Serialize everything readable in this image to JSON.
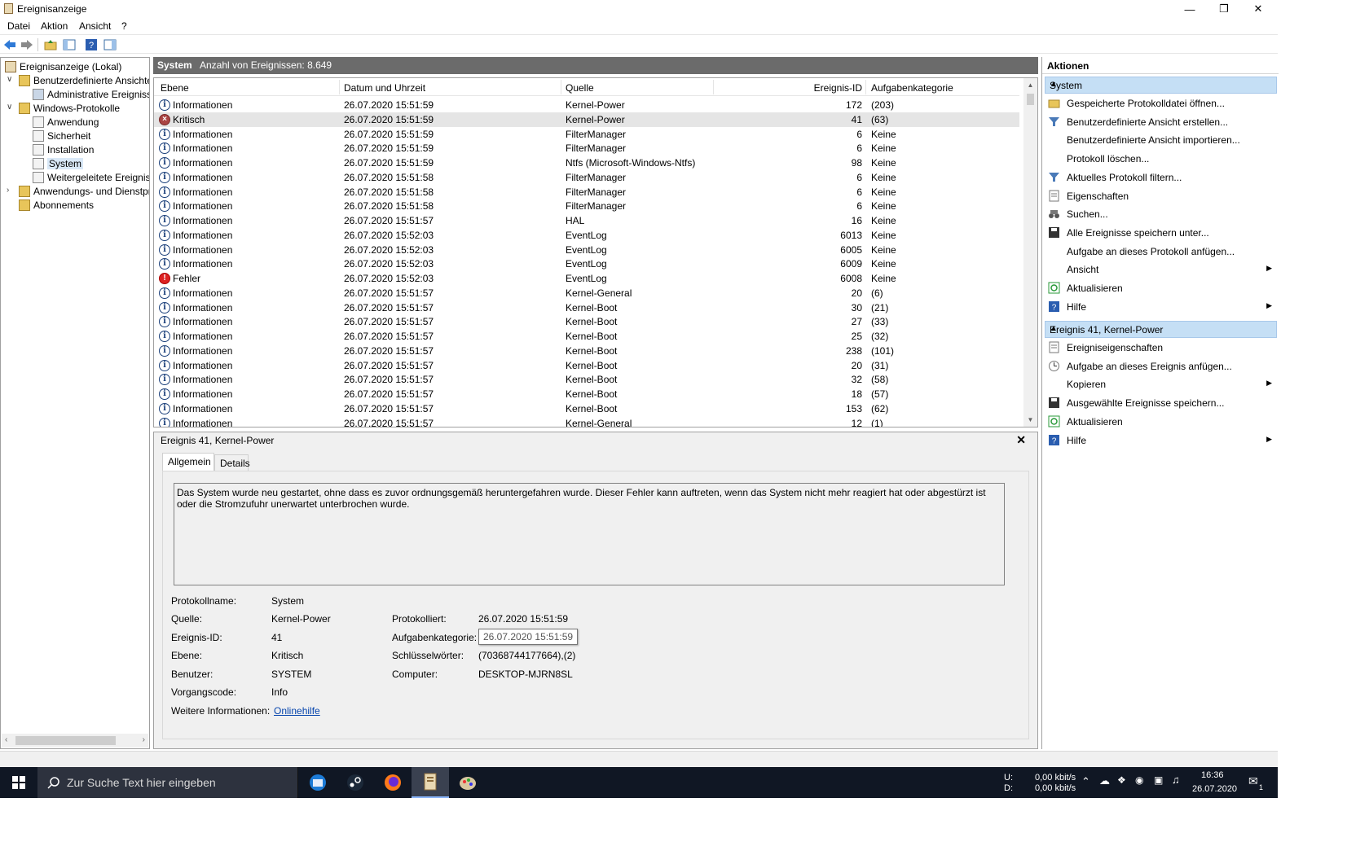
{
  "window": {
    "title": "Ereignisanzeige",
    "minimize": "—",
    "restore": "❐",
    "close": "✕"
  },
  "menu": [
    "Datei",
    "Aktion",
    "Ansicht",
    "?"
  ],
  "tree": {
    "root": "Ereignisanzeige (Lokal)",
    "custom_views": "Benutzerdefinierte Ansichten",
    "admin_events": "Administrative Ereignisse",
    "windows_logs": "Windows-Protokolle",
    "application": "Anwendung",
    "security": "Sicherheit",
    "setup": "Installation",
    "system": "System",
    "forwarded": "Weitergeleitete Ereignisse",
    "apps_services": "Anwendungs- und Dienstprotokolle",
    "subscriptions": "Abonnements"
  },
  "log": {
    "name": "System",
    "count": "Anzahl von Ereignissen: 8.649"
  },
  "columns": {
    "level": "Ebene",
    "datetime": "Datum und Uhrzeit",
    "source": "Quelle",
    "event_id": "Ereignis-ID",
    "category": "Aufgabenkategorie"
  },
  "events": [
    {
      "level": "Informationen",
      "type": "info",
      "datetime": "26.07.2020 15:51:59",
      "source": "Kernel-Power",
      "id": "172",
      "category": "(203)"
    },
    {
      "level": "Kritisch",
      "type": "crit",
      "datetime": "26.07.2020 15:51:59",
      "source": "Kernel-Power",
      "id": "41",
      "category": "(63)"
    },
    {
      "level": "Informationen",
      "type": "info",
      "datetime": "26.07.2020 15:51:59",
      "source": "FilterManager",
      "id": "6",
      "category": "Keine"
    },
    {
      "level": "Informationen",
      "type": "info",
      "datetime": "26.07.2020 15:51:59",
      "source": "FilterManager",
      "id": "6",
      "category": "Keine"
    },
    {
      "level": "Informationen",
      "type": "info",
      "datetime": "26.07.2020 15:51:59",
      "source": "Ntfs (Microsoft-Windows-Ntfs)",
      "id": "98",
      "category": "Keine"
    },
    {
      "level": "Informationen",
      "type": "info",
      "datetime": "26.07.2020 15:51:58",
      "source": "FilterManager",
      "id": "6",
      "category": "Keine"
    },
    {
      "level": "Informationen",
      "type": "info",
      "datetime": "26.07.2020 15:51:58",
      "source": "FilterManager",
      "id": "6",
      "category": "Keine"
    },
    {
      "level": "Informationen",
      "type": "info",
      "datetime": "26.07.2020 15:51:58",
      "source": "FilterManager",
      "id": "6",
      "category": "Keine"
    },
    {
      "level": "Informationen",
      "type": "info",
      "datetime": "26.07.2020 15:51:57",
      "source": "HAL",
      "id": "16",
      "category": "Keine"
    },
    {
      "level": "Informationen",
      "type": "info",
      "datetime": "26.07.2020 15:52:03",
      "source": "EventLog",
      "id": "6013",
      "category": "Keine"
    },
    {
      "level": "Informationen",
      "type": "info",
      "datetime": "26.07.2020 15:52:03",
      "source": "EventLog",
      "id": "6005",
      "category": "Keine"
    },
    {
      "level": "Informationen",
      "type": "info",
      "datetime": "26.07.2020 15:52:03",
      "source": "EventLog",
      "id": "6009",
      "category": "Keine"
    },
    {
      "level": "Fehler",
      "type": "err",
      "datetime": "26.07.2020 15:52:03",
      "source": "EventLog",
      "id": "6008",
      "category": "Keine"
    },
    {
      "level": "Informationen",
      "type": "info",
      "datetime": "26.07.2020 15:51:57",
      "source": "Kernel-General",
      "id": "20",
      "category": "(6)"
    },
    {
      "level": "Informationen",
      "type": "info",
      "datetime": "26.07.2020 15:51:57",
      "source": "Kernel-Boot",
      "id": "30",
      "category": "(21)"
    },
    {
      "level": "Informationen",
      "type": "info",
      "datetime": "26.07.2020 15:51:57",
      "source": "Kernel-Boot",
      "id": "27",
      "category": "(33)"
    },
    {
      "level": "Informationen",
      "type": "info",
      "datetime": "26.07.2020 15:51:57",
      "source": "Kernel-Boot",
      "id": "25",
      "category": "(32)"
    },
    {
      "level": "Informationen",
      "type": "info",
      "datetime": "26.07.2020 15:51:57",
      "source": "Kernel-Boot",
      "id": "238",
      "category": "(101)"
    },
    {
      "level": "Informationen",
      "type": "info",
      "datetime": "26.07.2020 15:51:57",
      "source": "Kernel-Boot",
      "id": "20",
      "category": "(31)"
    },
    {
      "level": "Informationen",
      "type": "info",
      "datetime": "26.07.2020 15:51:57",
      "source": "Kernel-Boot",
      "id": "32",
      "category": "(58)"
    },
    {
      "level": "Informationen",
      "type": "info",
      "datetime": "26.07.2020 15:51:57",
      "source": "Kernel-Boot",
      "id": "18",
      "category": "(57)"
    },
    {
      "level": "Informationen",
      "type": "info",
      "datetime": "26.07.2020 15:51:57",
      "source": "Kernel-Boot",
      "id": "153",
      "category": "(62)"
    },
    {
      "level": "Informationen",
      "type": "info",
      "datetime": "26.07.2020 15:51:57",
      "source": "Kernel-General",
      "id": "12",
      "category": "(1)"
    }
  ],
  "detail": {
    "title": "Ereignis 41, Kernel-Power",
    "tab_general": "Allgemein",
    "tab_details": "Details",
    "message": "Das System wurde neu gestartet, ohne dass es zuvor ordnungsgemäß heruntergefahren wurde. Dieser Fehler kann auftreten, wenn das System nicht mehr reagiert hat oder abgestürzt ist oder die Stromzufuhr unerwartet unterbrochen wurde.",
    "labels": {
      "logname": "Protokollname:",
      "source": "Quelle:",
      "event_id": "Ereignis-ID:",
      "level": "Ebene:",
      "user": "Benutzer:",
      "opcode": "Vorgangscode:",
      "more_info": "Weitere Informationen:",
      "logged": "Protokolliert:",
      "category": "Aufgabenkategorie:",
      "keywords": "Schlüsselwörter:",
      "computer": "Computer:"
    },
    "values": {
      "logname": "System",
      "source": "Kernel-Power",
      "event_id": "41",
      "level": "Kritisch",
      "user": "SYSTEM",
      "opcode": "Info",
      "more_info": "Onlinehilfe",
      "logged": "26.07.2020 15:51:59",
      "category_tooltip": "26.07.2020 15:51:59",
      "keywords": "(70368744177664),(2)",
      "computer": "DESKTOP-MJRN8SL"
    }
  },
  "actions": {
    "header": "Aktionen",
    "section_system": "System",
    "system_items": [
      {
        "label": "Gespeicherte Protokolldatei öffnen...",
        "icon": "folder-open-icon",
        "arrow": false
      },
      {
        "label": "Benutzerdefinierte Ansicht erstellen...",
        "icon": "filter-icon",
        "arrow": false
      },
      {
        "label": "Benutzerdefinierte Ansicht importieren...",
        "icon": "",
        "arrow": false
      },
      {
        "label": "Protokoll löschen...",
        "icon": "",
        "arrow": false
      },
      {
        "label": "Aktuelles Protokoll filtern...",
        "icon": "filter-icon",
        "arrow": false
      },
      {
        "label": "Eigenschaften",
        "icon": "properties-icon",
        "arrow": false
      },
      {
        "label": "Suchen...",
        "icon": "binoculars-icon",
        "arrow": false
      },
      {
        "label": "Alle Ereignisse speichern unter...",
        "icon": "save-icon",
        "arrow": false
      },
      {
        "label": "Aufgabe an dieses Protokoll anfügen...",
        "icon": "",
        "arrow": false
      },
      {
        "label": "Ansicht",
        "icon": "",
        "arrow": true
      },
      {
        "label": "Aktualisieren",
        "icon": "refresh-icon",
        "arrow": false
      },
      {
        "label": "Hilfe",
        "icon": "help-icon",
        "arrow": true
      }
    ],
    "section_event": "Ereignis 41, Kernel-Power",
    "event_items": [
      {
        "label": "Ereigniseigenschaften",
        "icon": "properties-icon",
        "arrow": false
      },
      {
        "label": "Aufgabe an dieses Ereignis anfügen...",
        "icon": "task-icon",
        "arrow": false
      },
      {
        "label": "Kopieren",
        "icon": "",
        "arrow": true
      },
      {
        "label": "Ausgewählte Ereignisse speichern...",
        "icon": "save-icon",
        "arrow": false
      },
      {
        "label": "Aktualisieren",
        "icon": "refresh-icon",
        "arrow": false
      },
      {
        "label": "Hilfe",
        "icon": "help-icon",
        "arrow": true
      }
    ]
  },
  "taskbar": {
    "search_placeholder": "Zur Suche Text hier eingeben",
    "net_u_label": "U:",
    "net_d_label": "D:",
    "net_u_value": "0,00 kbit/s",
    "net_d_value": "0,00 kbit/s",
    "time": "16:36",
    "date": "26.07.2020",
    "notification_count": "1"
  }
}
